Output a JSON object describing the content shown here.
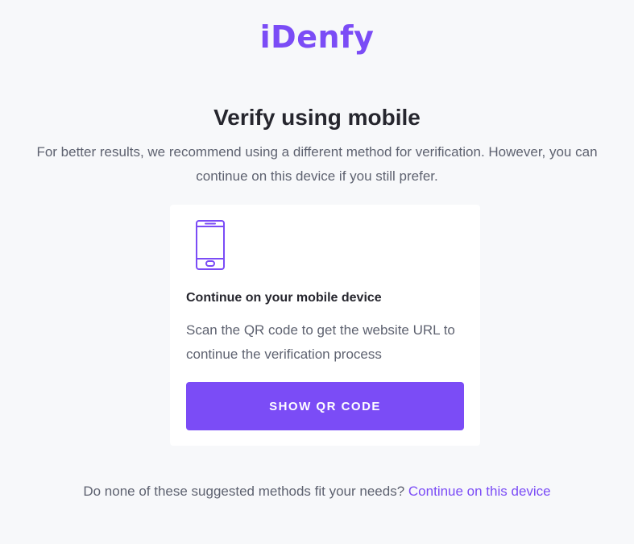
{
  "brand": {
    "logo_text": "iDenfy",
    "accent_color": "#7b4cf6"
  },
  "header": {
    "title": "Verify using mobile",
    "subtitle": "For better results, we recommend using a different method for verification. However, you can continue on this device if you still prefer."
  },
  "card": {
    "icon": "mobile-phone-icon",
    "heading": "Continue on your mobile device",
    "description": "Scan the QR code to get the website URL to continue the verification process",
    "button_label": "SHOW QR CODE"
  },
  "footer": {
    "question": "Do none of these suggested methods fit your needs?",
    "link_label": "Continue on this device"
  }
}
